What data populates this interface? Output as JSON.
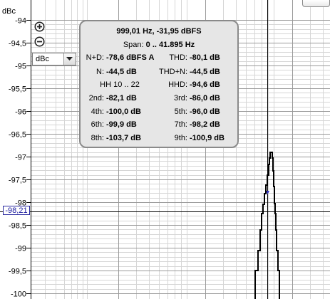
{
  "axis": {
    "unit": "dBc",
    "ticks": [
      "-94",
      "-94,5",
      "-95",
      "-95,5",
      "-96",
      "-96,5",
      "-97",
      "-97,5",
      "-98",
      "-98,5",
      "-99",
      "-99,5",
      "-100"
    ]
  },
  "cursor": {
    "value_label": "-98,21",
    "y_value": -98.21
  },
  "unit_select": {
    "selected": "dBc"
  },
  "panel": {
    "title": "999,01 Hz, -31,95 dBFS",
    "span_prefix": "Span:",
    "span_value": "0 .. 41.895 Hz",
    "hh_range": "HH 10 .. 22",
    "left": [
      {
        "label": "N+D:",
        "value": "-78,6 dBFS A"
      },
      {
        "label": "N:",
        "value": "-44,5 dB"
      },
      {
        "label": "2nd:",
        "value": "-82,1 dB"
      },
      {
        "label": "4th:",
        "value": "-100,0 dB"
      },
      {
        "label": "6th:",
        "value": "-99,9 dB"
      },
      {
        "label": "8th:",
        "value": "-103,7 dB"
      }
    ],
    "right": [
      {
        "label": "THD:",
        "value": "-80,1 dB"
      },
      {
        "label": "THD+N:",
        "value": "-44,5 dB"
      },
      {
        "label": "HHD:",
        "value": "-94,6 dB"
      },
      {
        "label": "3rd:",
        "value": "-86,0 dB"
      },
      {
        "label": "5th:",
        "value": "-96,0 dB"
      },
      {
        "label": "7th:",
        "value": "-98,2 dB"
      },
      {
        "label": "9th:",
        "value": "-100,9 dB"
      }
    ]
  },
  "colors": {
    "grid_minor": "#d6d6d6",
    "grid_major": "#9a9a9a",
    "trace": "#000000",
    "cursor": "#000000",
    "cursor_label": "#1a1aa0"
  },
  "chart_data": {
    "type": "line",
    "ylabel": "dBc",
    "ylim": [
      -100,
      -94
    ],
    "peak": -96.9
  }
}
